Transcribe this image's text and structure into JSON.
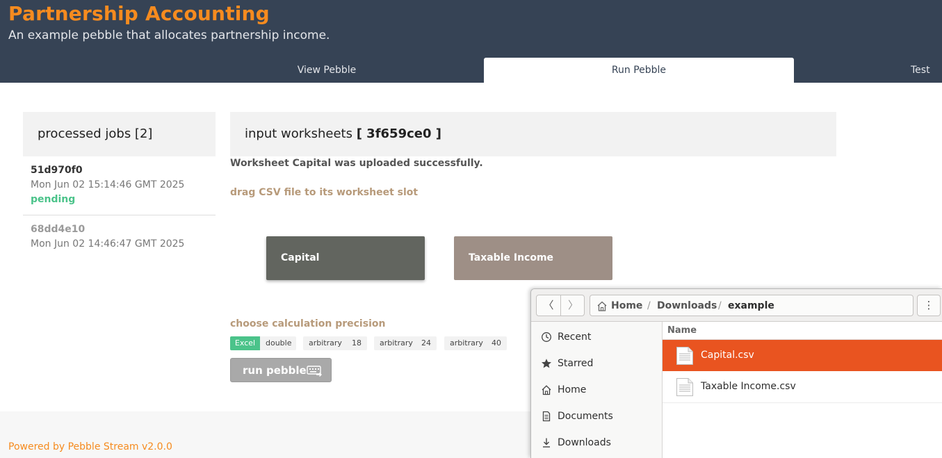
{
  "header": {
    "title": "Partnership Accounting",
    "subtitle": "An example pebble that allocates partnership income.",
    "tabs": [
      {
        "label": "View Pebble",
        "active": false
      },
      {
        "label": "Run Pebble",
        "active": true
      },
      {
        "label": "Test",
        "active": false
      }
    ]
  },
  "jobs": {
    "title": "processed jobs [2]",
    "items": [
      {
        "id": "51d970f0",
        "date": "Mon Jun 02 15:14:46 GMT 2025",
        "status": "pending"
      },
      {
        "id": "68dd4e10",
        "date": "Mon Jun 02 14:46:47 GMT 2025"
      }
    ]
  },
  "main": {
    "ws_title_prefix": "input worksheets ",
    "ws_id": "[ 3f659ce0 ]",
    "success_msg": "Worksheet Capital was uploaded successfully.",
    "drag_hint": "drag CSV file to its worksheet slot",
    "slots": [
      {
        "label": "Capital",
        "color": "#62655f"
      },
      {
        "label": "Taxable Income",
        "color": "#9e8f86"
      }
    ],
    "precision": {
      "label": "choose calculation precision",
      "options": [
        {
          "a": "Excel",
          "b": "double",
          "selected": true
        },
        {
          "a": "arbitrary",
          "b": "18"
        },
        {
          "a": "arbitrary",
          "b": "24"
        },
        {
          "a": "arbitrary",
          "b": "40"
        }
      ]
    },
    "run_label": "run pebble"
  },
  "footer": {
    "text": "Powered by Pebble Stream v2.0.0"
  },
  "file_dialog": {
    "path": [
      "Home",
      "Downloads",
      "example"
    ],
    "path_separator": "/",
    "back_glyph": "〈",
    "forward_glyph": "〉",
    "menu_glyph": "⋮",
    "places": [
      {
        "label": "Recent",
        "icon": "clock-icon"
      },
      {
        "label": "Starred",
        "icon": "star-icon"
      },
      {
        "label": "Home",
        "icon": "home-icon"
      },
      {
        "label": "Documents",
        "icon": "document-icon"
      },
      {
        "label": "Downloads",
        "icon": "download-icon"
      }
    ],
    "column_name": "Name",
    "files": [
      {
        "name": "Capital.csv",
        "selected": true
      },
      {
        "name": "Taxable Income.csv",
        "selected": false
      }
    ]
  },
  "colors": {
    "accent_orange": "#f68b1f",
    "header_bg": "#364355",
    "success_green": "#4bc38a",
    "selection": "#e95420"
  }
}
